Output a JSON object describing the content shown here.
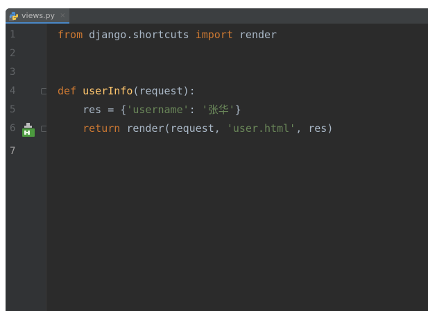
{
  "tab": {
    "filename": "views.py",
    "close_glyph": "×",
    "icon": "python-file-icon"
  },
  "gutter": {
    "line_numbers": [
      "1",
      "2",
      "3",
      "4",
      "5",
      "6",
      "7"
    ],
    "current_line": "7",
    "run_icon": "django-template-run-icon"
  },
  "code": {
    "line1": {
      "kw1": "from",
      "mod": " django.shortcuts ",
      "kw2": "import",
      "name": " render"
    },
    "line4": {
      "kw": "def",
      "fn": "userInfo",
      "rest": "(request):"
    },
    "line5": {
      "lead": "    res = {",
      "key": "'username'",
      "colon": ": ",
      "val": "'张华'",
      "close": "}"
    },
    "line6": {
      "lead": "    ",
      "kw": "return",
      "call": " render(request, ",
      "tpl": "'user.html'",
      "sep": ", res)"
    }
  },
  "colors": {
    "editor_bg": "#2b2b2b",
    "gutter_bg": "#313335",
    "keyword": "#cc7832",
    "function": "#ffc66d",
    "string": "#6a8759",
    "text": "#a9b7c6"
  }
}
